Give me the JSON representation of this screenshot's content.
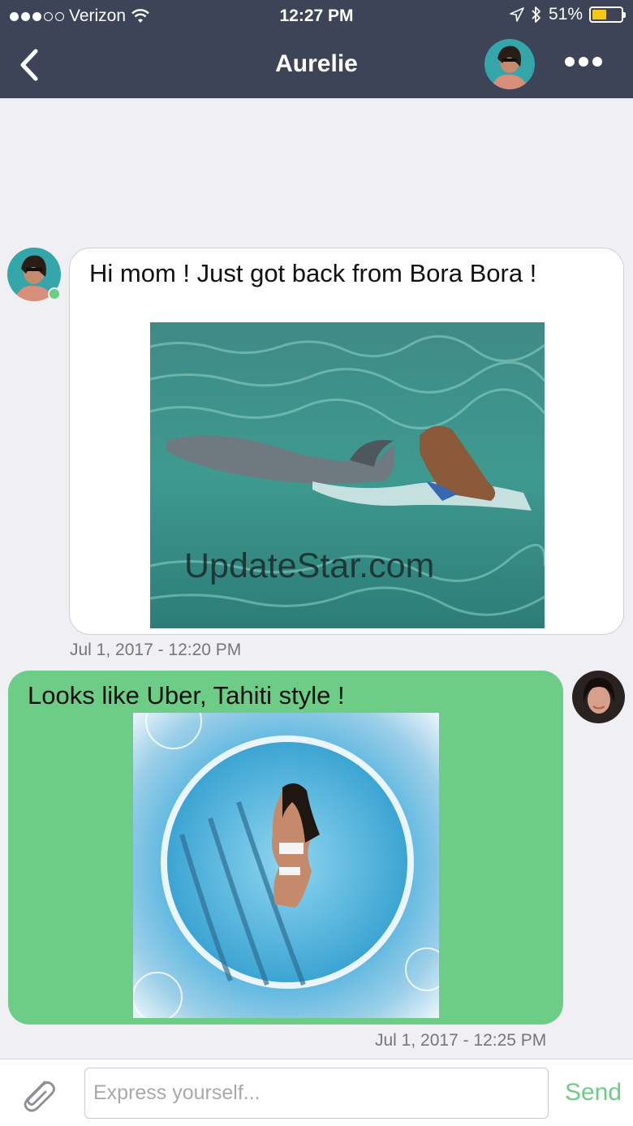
{
  "status_bar": {
    "carrier": "Verizon",
    "time": "12:27 PM",
    "battery_percent": "51%",
    "battery_level": 0.51,
    "signal_bars_filled": 3,
    "signal_bars_total": 5
  },
  "header": {
    "title": "Aurelie",
    "back_icon": "chevron-left-icon",
    "more_icon": "ellipsis-icon"
  },
  "messages": [
    {
      "direction": "incoming",
      "text": "Hi mom ! Just got back from Bora Bora !",
      "image_watermark": "UpdateStar.com",
      "timestamp": "Jul 1, 2017 - 12:20 PM",
      "sender_online": true
    },
    {
      "direction": "outgoing",
      "text": "Looks like Uber, Tahiti style !",
      "timestamp": "Jul 1, 2017 - 12:25 PM"
    }
  ],
  "composer": {
    "placeholder": "Express yourself...",
    "send_label": "Send",
    "attach_icon": "paperclip-icon"
  },
  "colors": {
    "header_bg": "#3e4457",
    "outgoing_bubble": "#6dcc86",
    "online_dot": "#6ccc85",
    "send_text": "#6dcc86"
  }
}
